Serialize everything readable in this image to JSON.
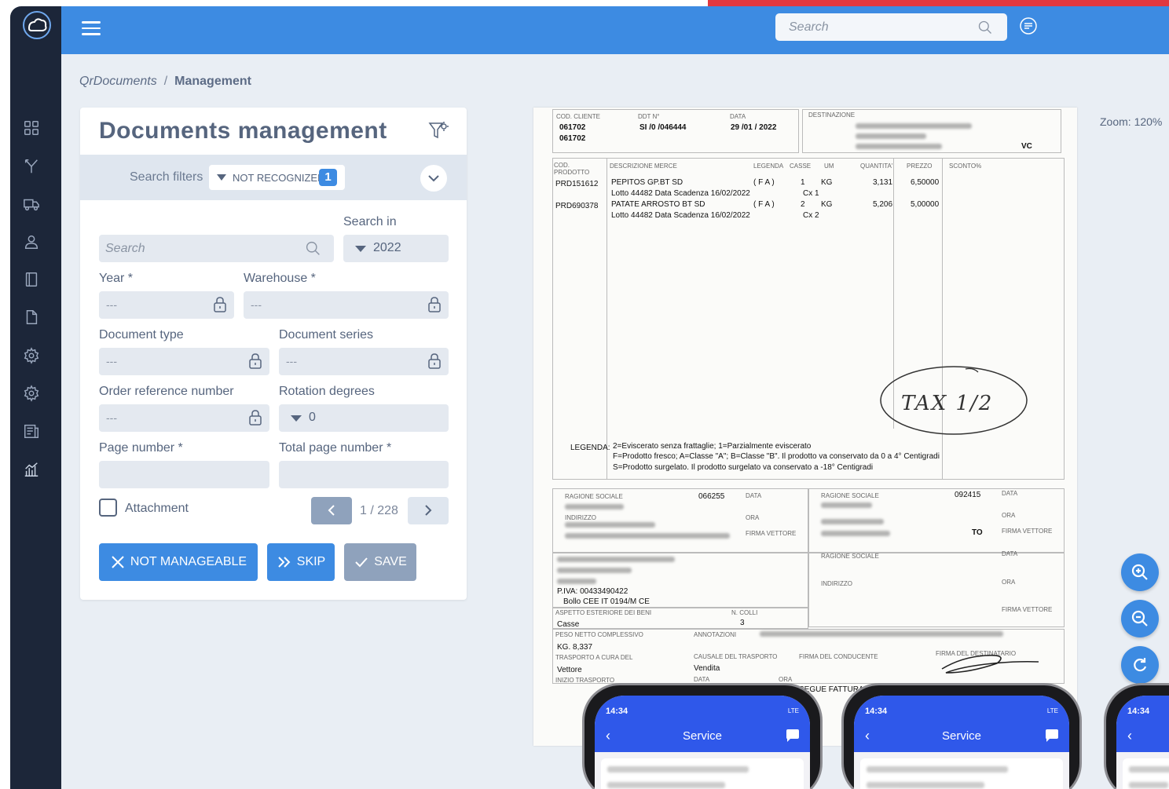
{
  "topbar": {
    "search_placeholder": "Search",
    "menu_icon": "hamburger-icon",
    "search_icon": "search-icon",
    "chat_icon": "chat-icon"
  },
  "sidebar": {
    "logo": "cloud-logo",
    "items": [
      {
        "icon": "dashboard-icon"
      },
      {
        "icon": "merge-icon"
      },
      {
        "icon": "truck-icon"
      },
      {
        "icon": "user-icon"
      },
      {
        "icon": "book-icon"
      },
      {
        "icon": "document-icon"
      },
      {
        "icon": "gear-icon"
      },
      {
        "icon": "gear-icon"
      },
      {
        "icon": "report-icon"
      },
      {
        "icon": "chart-icon"
      }
    ]
  },
  "breadcrumb": {
    "first": "QrDocuments",
    "separator": "/",
    "current": "Management"
  },
  "panel": {
    "title": "Documents management",
    "filters_label": "Search filters",
    "filter_chip_label": "NOT RECOGNIZED",
    "filter_chip_count": "1",
    "search_in_label": "Search in",
    "search_placeholder": "Search",
    "search_in_value": "2022",
    "year_label": "Year *",
    "year_value": "---",
    "warehouse_label": "Warehouse *",
    "warehouse_value": "---",
    "doc_type_label": "Document type",
    "doc_type_value": "---",
    "doc_series_label": "Document series",
    "doc_series_value": "---",
    "order_ref_label": "Order reference number",
    "order_ref_value": "---",
    "rotation_label": "Rotation degrees",
    "rotation_value": "0",
    "page_number_label": "Page number *",
    "page_number_value": "",
    "total_page_label": "Total page number *",
    "total_page_value": "",
    "attachment_label": "Attachment",
    "attachment_checked": false,
    "pager_text": "1 / 228",
    "btn_not_manageable": "NOT MANAGEABLE",
    "btn_skip": "SKIP",
    "btn_save": "SAVE"
  },
  "colors": {
    "primary": "#3d8be2",
    "sidebar": "#1c2639",
    "text": "#56657e",
    "accent_red": "#e2383f",
    "disabled": "#8fa2bc"
  },
  "viewer": {
    "zoom_label": "Zoom: 120%",
    "zoom_in_icon": "zoom-in-icon",
    "zoom_out_icon": "zoom-out-icon",
    "rotate_icon": "rotate-icon"
  },
  "document": {
    "cod_cliente_label": "COD. CLIENTE",
    "cod_cliente_1": "061702",
    "cod_cliente_2": "061702",
    "ddt_label": "DDT N°",
    "ddt_value": "SI /0 /046444",
    "data_label": "DATA",
    "data_value": "29 /01 / 2022",
    "destinazione_label": "DESTINAZIONE",
    "dest_suffix": "VC",
    "cod_prodotto_label": "COD. PRODOTTO",
    "descrizione_label": "DESCRIZIONE MERCE",
    "legenda_label": "LEGENDA",
    "casse_label": "CASSE",
    "um_label": "UM",
    "quantita_label": "QUANTITA'",
    "prezzo_label": "PREZZO",
    "sconto_label": "SCONTO%",
    "rows": [
      {
        "code": "PRD151612",
        "desc": "PEPITOS GP.BT SD",
        "lotto": "Lotto 44482  Data Scadenza 16/02/2022",
        "leg": "( F A )",
        "casse": "1",
        "cx": "Cx  1",
        "um": "KG",
        "qty": "3,131",
        "price": "6,50000"
      },
      {
        "code": "PRD690378",
        "desc": "PATATE ARROSTO BT SD",
        "lotto": "Lotto 44482  Data Scadenza 16/02/2022",
        "leg": "( F A )",
        "casse": "2",
        "cx": "Cx  2",
        "um": "KG",
        "qty": "5,206",
        "price": "5,00000"
      }
    ],
    "handwriting": "TAX  1/2",
    "legenda_title": "LEGENDA:",
    "legenda_lines": [
      "2=Eviscerato senza frattaglie; 1=Parzialmente eviscerato",
      "F=Prodotto fresco; A=Classe \"A\"; B=Classe \"B\". Il prodotto va conservato da 0 a 4° Centigradi",
      "S=Prodotto surgelato. Il prodotto surgelato va conservato a -18° Centigradi"
    ],
    "ragione_sociale_label": "RAGIONE SOCIALE",
    "rs_code_1": "066255",
    "rs_code_2": "092415",
    "indirizzo_label": "INDIRIZZO",
    "data_small": "DATA",
    "ora_small": "ORA",
    "firma_vettore": "FIRMA VETTORE",
    "vettore_label": "VETTORE",
    "to_value": "TO",
    "piva": "P.IVA: 00433490422",
    "bollo": "Bollo CEE IT 0194/M CE",
    "aspetto_label": "ASPETTO ESTERIORE DEI BENI",
    "ncolli_label": "N. COLLI",
    "aspetto_value": "Casse",
    "ncolli_value": "3",
    "peso_label": "PESO NETTO COMPLESSIVO",
    "annotazioni_label": "ANNOTAZIONI",
    "peso_value": "KG.    8,337",
    "trasporto_label": "TRASPORTO A CURA DEL",
    "causale_label": "CAUSALE DEL TRASPORTO",
    "firma_conducente": "FIRMA DEL CONDUCENTE",
    "firma_destinatario": "FIRMA DEL DESTINATARIO",
    "trasporto_value": "Vettore",
    "causale_value": "Vendita",
    "inizio_label": "INIZIO TRASPORTO",
    "segue": "SEGUE FATTURA"
  },
  "phones": [
    {
      "time": "14:34",
      "status": "LTE",
      "title": "Service"
    },
    {
      "time": "14:34",
      "status": "LTE",
      "title": "Service"
    },
    {
      "time": "14:34",
      "status": "",
      "title": ""
    }
  ]
}
